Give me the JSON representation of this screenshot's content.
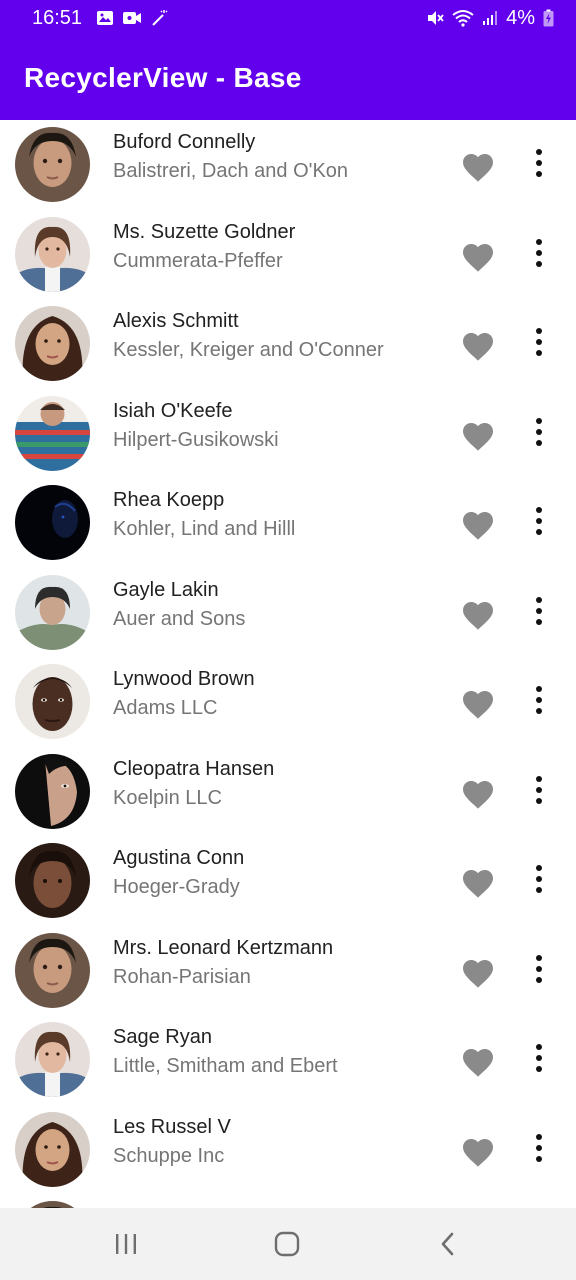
{
  "status_bar": {
    "time": "16:51",
    "battery": "4%",
    "left_icons": [
      "gallery-icon",
      "video-icon",
      "magic-wand-icon"
    ],
    "right_icons": [
      "mute-icon",
      "wifi-icon",
      "signal-icon",
      "battery-charging-icon"
    ]
  },
  "app_bar": {
    "title": "RecyclerView - Base",
    "background_color": "#6200ee"
  },
  "colors": {
    "primary": "#6200ee",
    "name_text": "#212121",
    "company_text": "#757575",
    "heart": "#8a8a8a",
    "more": "#111111",
    "nav_bg": "#f2f2f2"
  },
  "contacts": [
    {
      "name": "Buford Connelly",
      "company": "Balistreri, Dach and O'Kon"
    },
    {
      "name": "Ms. Suzette Goldner",
      "company": "Cummerata-Pfeffer"
    },
    {
      "name": "Alexis Schmitt",
      "company": "Kessler, Kreiger and O'Conner"
    },
    {
      "name": "Isiah O'Keefe",
      "company": "Hilpert-Gusikowski"
    },
    {
      "name": "Rhea Koepp",
      "company": "Kohler, Lind and Hilll"
    },
    {
      "name": "Gayle Lakin",
      "company": "Auer and Sons"
    },
    {
      "name": "Lynwood Brown",
      "company": "Adams LLC"
    },
    {
      "name": "Cleopatra Hansen",
      "company": "Koelpin LLC"
    },
    {
      "name": "Agustina Conn",
      "company": "Hoeger-Grady"
    },
    {
      "name": "Mrs. Leonard Kertzmann",
      "company": "Rohan-Parisian"
    },
    {
      "name": "Sage Ryan",
      "company": "Little, Smitham and Ebert"
    },
    {
      "name": "Les Russel V",
      "company": "Schuppe Inc"
    }
  ],
  "row_actions": {
    "favorite_icon": "heart-icon",
    "more_icon": "more-vertical-icon"
  },
  "nav_bar": {
    "buttons": [
      "recent-apps-icon",
      "home-icon",
      "back-icon"
    ]
  }
}
